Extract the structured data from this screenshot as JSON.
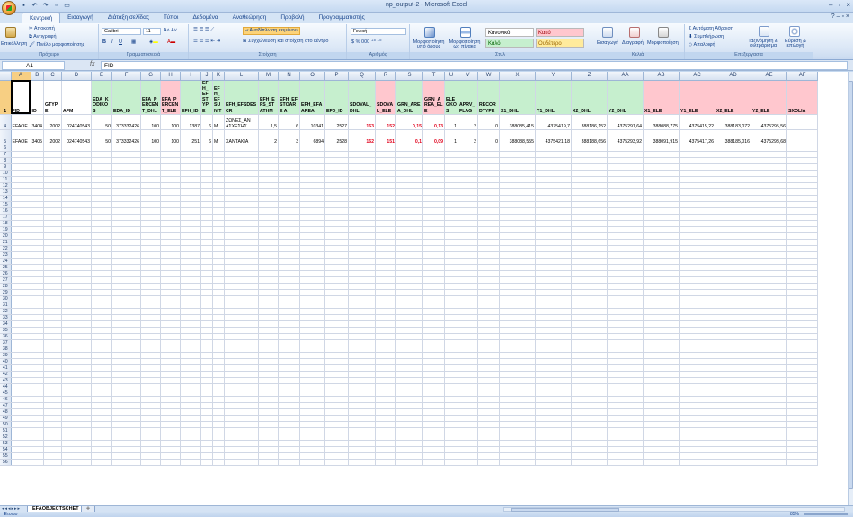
{
  "window": {
    "title": "np_output-2 - Microsoft Excel",
    "qat": [
      "save-icon",
      "undo-icon",
      "redo-icon",
      "print-icon",
      "preview-icon"
    ]
  },
  "ribbon": {
    "tabs": [
      "Κεντρική",
      "Εισαγωγή",
      "Διάταξη σελίδας",
      "Τύποι",
      "Δεδομένα",
      "Αναθεώρηση",
      "Προβολή",
      "Προγραμματιστής"
    ],
    "active_tab": 0,
    "clipboard": {
      "paste": "Επικόλληση",
      "cut": "Αποκοπή",
      "copy": "Αντιγραφή",
      "format_painter": "Πινέλο μορφοποίησης",
      "label": "Πρόχειρο"
    },
    "font": {
      "name": "Calibri",
      "size": "11",
      "label": "Γραμματοσειρά"
    },
    "alignment": {
      "wrap": "Αναδίπλωση κειμένου",
      "merge": "Συγχώνευση και στοίχιση στο κέντρο",
      "label": "Στοίχιση"
    },
    "number": {
      "format": "Γενική",
      "label": "Αριθμός"
    },
    "styles": {
      "conditional": "Μορφοποίηση υπό όρους",
      "as_table": "Μορφοποίηση ως πίνακα",
      "normal": "Κανονικό",
      "bad": "Κακό",
      "good": "Καλό",
      "neutral": "Ουδέτερο",
      "label": "Στυλ"
    },
    "cells": {
      "insert": "Εισαγωγή",
      "delete": "Διαγραφή",
      "format": "Μορφοποίηση",
      "label": "Κελιά"
    },
    "editing": {
      "autosum": "Αυτόματη Άθροιση",
      "fill": "Συμπλήρωση",
      "clear": "Απαλοιφή",
      "sort": "Ταξινόμηση & φιλτράρισμα",
      "find": "Εύρεση & επιλογή",
      "label": "Επεξεργασία"
    }
  },
  "formula_bar": {
    "cell": "A1",
    "fx": "fx",
    "value": "FID"
  },
  "grid": {
    "columns": [
      "A",
      "B",
      "C",
      "D",
      "E",
      "F",
      "G",
      "H",
      "I",
      "J",
      "K",
      "L",
      "M",
      "N",
      "O",
      "P",
      "Q",
      "R",
      "S",
      "T",
      "U",
      "V",
      "W",
      "X",
      "Y",
      "Z",
      "AA",
      "AB",
      "AC",
      "AD",
      "AE",
      "AF"
    ],
    "headers": [
      "FID",
      "ID",
      "GTYPE",
      "AFM",
      "EDA_KODIKOS",
      "EDA_ID",
      "EFA_PERCENT_DHL",
      "EFA_PERCENT_ELE",
      "EFH_ID",
      "EFH_EFSTYPE",
      "EFH_EFSUNIT",
      "EFH_EFSDESCR",
      "EFH_EFS_STATHM",
      "EFH_EFSTOARE A",
      "EFH_EFA AREA",
      "EFD_ID",
      "SDOVAL_DHL",
      "SDOVAL_ELE",
      "GRN_AREA_DHL",
      "GRN_AREA_ELE",
      "ELEGKOS",
      "APRV_FLAG",
      "RECORDTYPE",
      "X1_DHL",
      "Y1_DHL",
      "X2_DHL",
      "Y2_DHL",
      "X1_ELE",
      "Y1_ELE",
      "X2_ELE",
      "Y2_ELE",
      "SXOLIA"
    ],
    "rows": [
      [
        "EFAOE",
        "3404",
        "2002",
        "024740543",
        "50",
        "373332426",
        "100",
        "100",
        "1387",
        "6",
        "M",
        "ΖΩΝΕΣ_ΑΝ ΑΣΧΕΣΗΣ",
        "1,5",
        "6",
        "10341",
        "2527",
        "163",
        "152",
        "0,15",
        "0,13",
        "1",
        "2",
        "0",
        "388085,415",
        "4375419,7",
        "388186,152",
        "4375291,64",
        "388088,775",
        "4375415,22",
        "388183,072",
        "4375295,56",
        ""
      ],
      [
        "EFAOE",
        "3405",
        "2002",
        "024740543",
        "50",
        "373332426",
        "100",
        "100",
        "251",
        "6",
        "M",
        "ΧΑΝΤΑΚΙΑ",
        "2",
        "3",
        "6894",
        "2528",
        "162",
        "151",
        "0,1",
        "0,09",
        "1",
        "2",
        "0",
        "388088,555",
        "4375421,18",
        "388188,656",
        "4375293,92",
        "388091,915",
        "4375417,26",
        "388185,016",
        "4375298,68",
        ""
      ]
    ],
    "row_count": 56
  },
  "sheets": {
    "active": "EFAOBJECTSCHET"
  },
  "status": {
    "ready": "Έτοιμο",
    "zoom": "85%"
  }
}
